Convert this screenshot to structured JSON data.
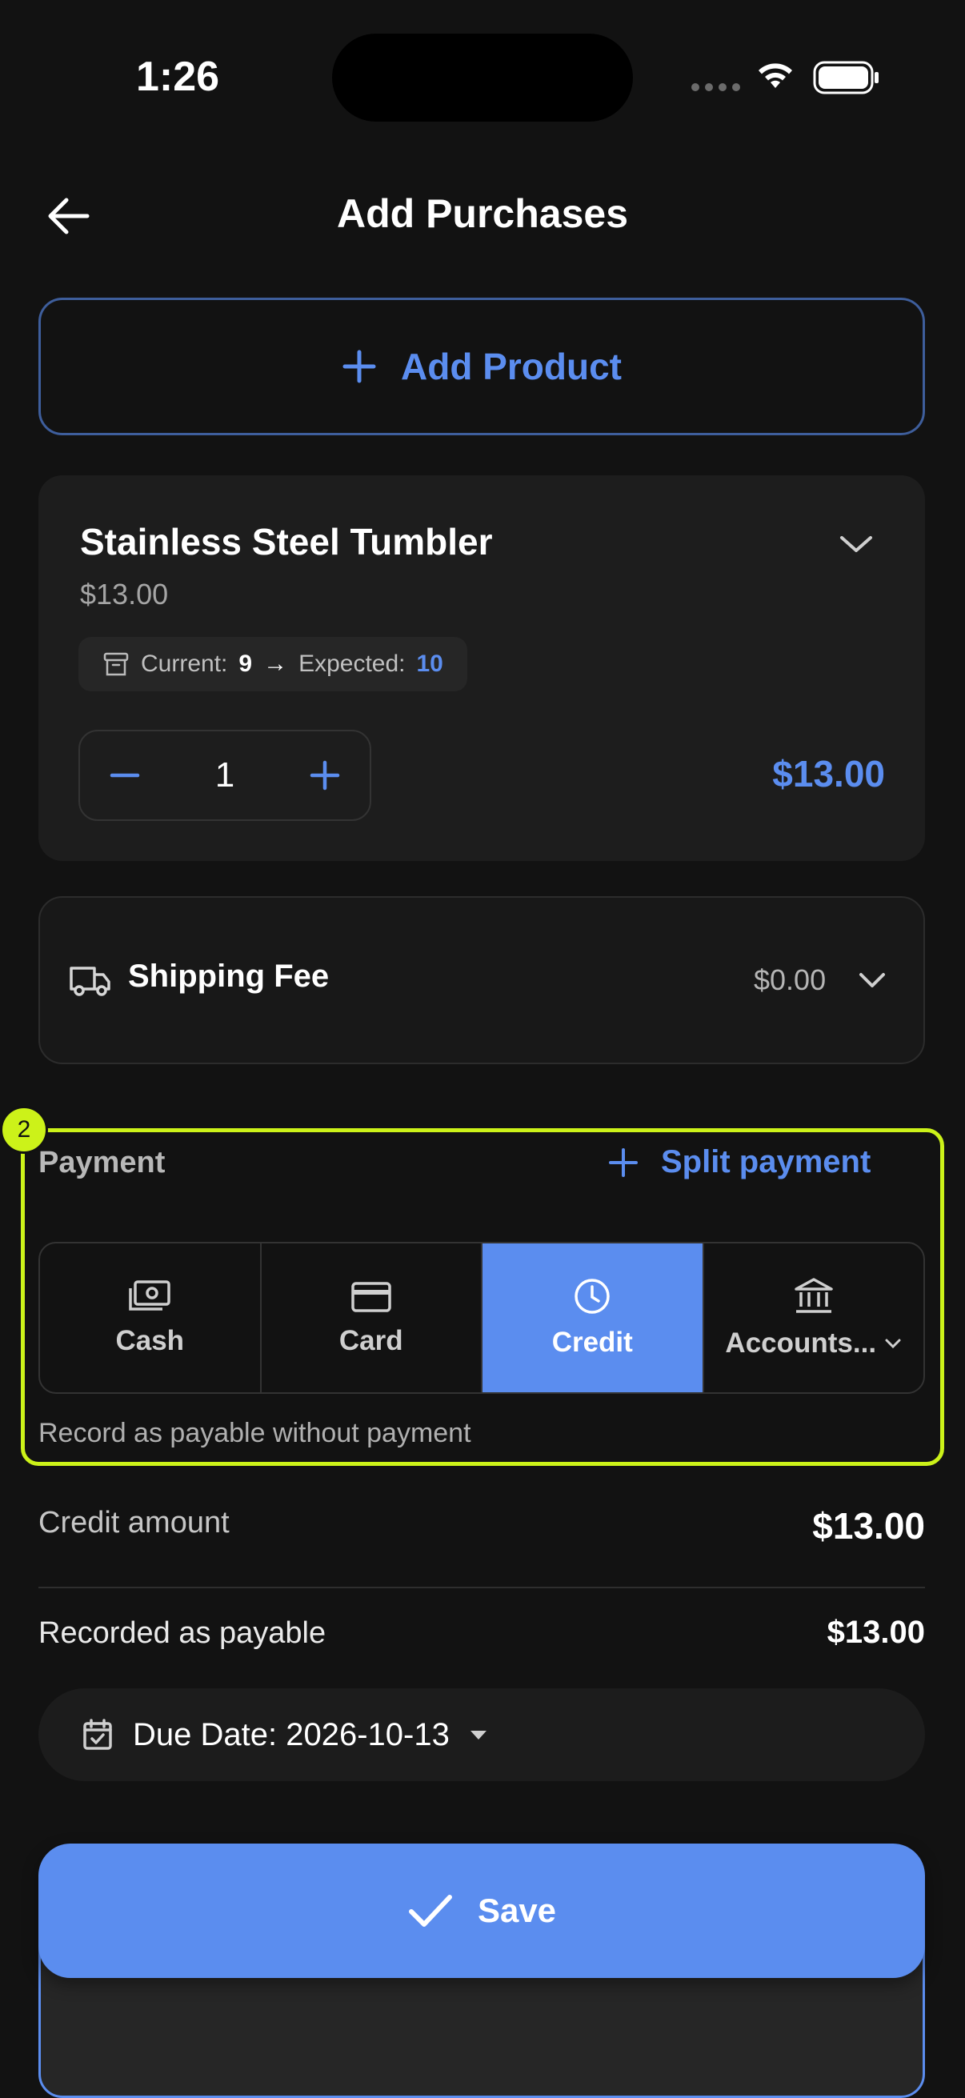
{
  "status_bar": {
    "time": "1:26"
  },
  "header": {
    "title": "Add Purchases",
    "back_icon": "arrow-left-icon"
  },
  "add_product": {
    "label": "Add Product"
  },
  "product": {
    "name": "Stainless Steel Tumbler",
    "unit_price": "$13.00",
    "current_label": "Current:",
    "current_value": "9",
    "arrow": "→",
    "expected_label": "Expected:",
    "expected_value": "10",
    "quantity": "1",
    "line_total": "$13.00"
  },
  "shipping": {
    "label": "Shipping Fee",
    "value": "$0.00"
  },
  "payment": {
    "badge": "2",
    "label": "Payment",
    "split_label": "Split payment",
    "methods": [
      {
        "label": "Cash",
        "icon": "cash-icon",
        "active": false
      },
      {
        "label": "Card",
        "icon": "card-icon",
        "active": false
      },
      {
        "label": "Credit",
        "icon": "clock-icon",
        "active": true
      },
      {
        "label": "Accounts...",
        "icon": "bank-icon",
        "active": false
      }
    ],
    "hint": "Record as payable without payment"
  },
  "credit": {
    "amount_label": "Credit amount",
    "amount_value": "$13.00",
    "payable_label": "Recorded as payable",
    "payable_value": "$13.00"
  },
  "due_date": {
    "label": "Due Date: 2026-10-13"
  },
  "save": {
    "label": "Save"
  },
  "colors": {
    "accent": "#5b8def",
    "highlight": "#ccf219",
    "background": "#121212"
  }
}
